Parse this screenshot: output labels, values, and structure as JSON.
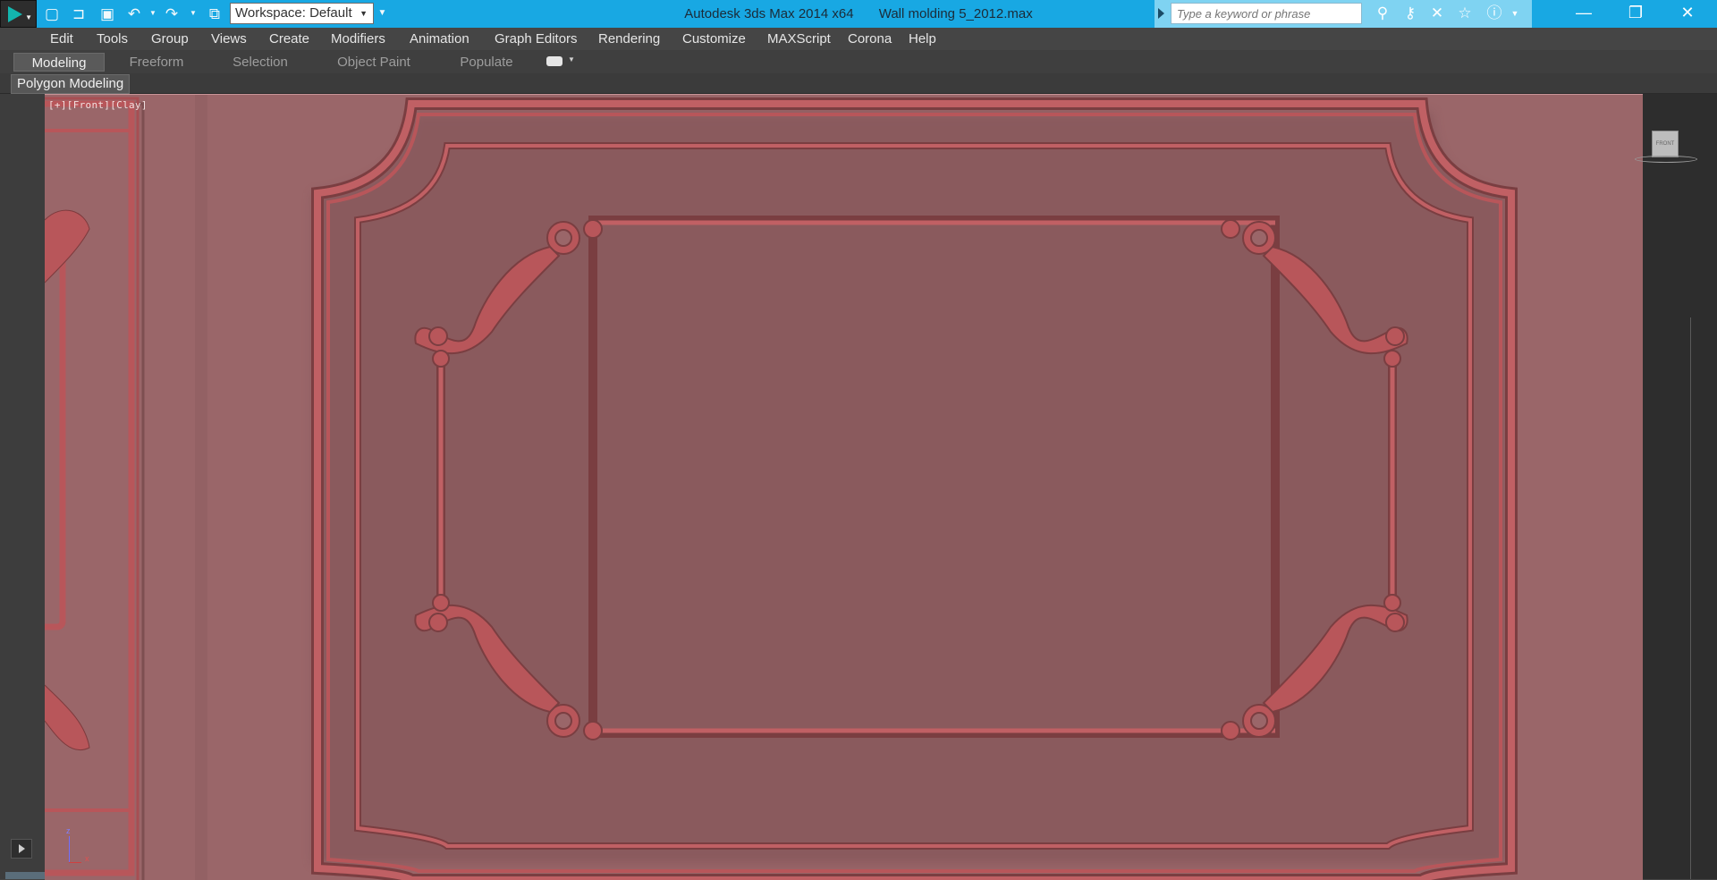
{
  "titlebar": {
    "app_name": "Autodesk 3ds Max  2014 x64",
    "file_name": "Wall molding 5_2012.max",
    "workspace_label": "Workspace: Default",
    "search_placeholder": "Type a keyword or phrase",
    "quick_access_icons": [
      "new-file-icon",
      "open-file-icon",
      "save-icon",
      "undo-icon",
      "redo-icon",
      "project-folder-icon"
    ],
    "search_tools": [
      "binoculars-icon",
      "key-icon",
      "exchange-icon",
      "star-icon",
      "help-icon"
    ],
    "accent": "#18a8e3"
  },
  "menu": {
    "items": [
      "Edit",
      "Tools",
      "Group",
      "Views",
      "Create",
      "Modifiers",
      "Animation",
      "Graph Editors",
      "Rendering",
      "Customize",
      "MAXScript",
      "Corona",
      "Help"
    ]
  },
  "ribbon": {
    "tabs": [
      "Modeling",
      "Freeform",
      "Selection",
      "Object Paint",
      "Populate"
    ],
    "active_tab": "Modeling",
    "panel_label": "Polygon Modeling"
  },
  "viewport": {
    "label": "[+][Front][Clay]",
    "viewcube_face": "FRONT",
    "axis_z": "z",
    "axis_x": "x",
    "clay_color": "#9a6669",
    "molding_color": "#b8565a"
  }
}
